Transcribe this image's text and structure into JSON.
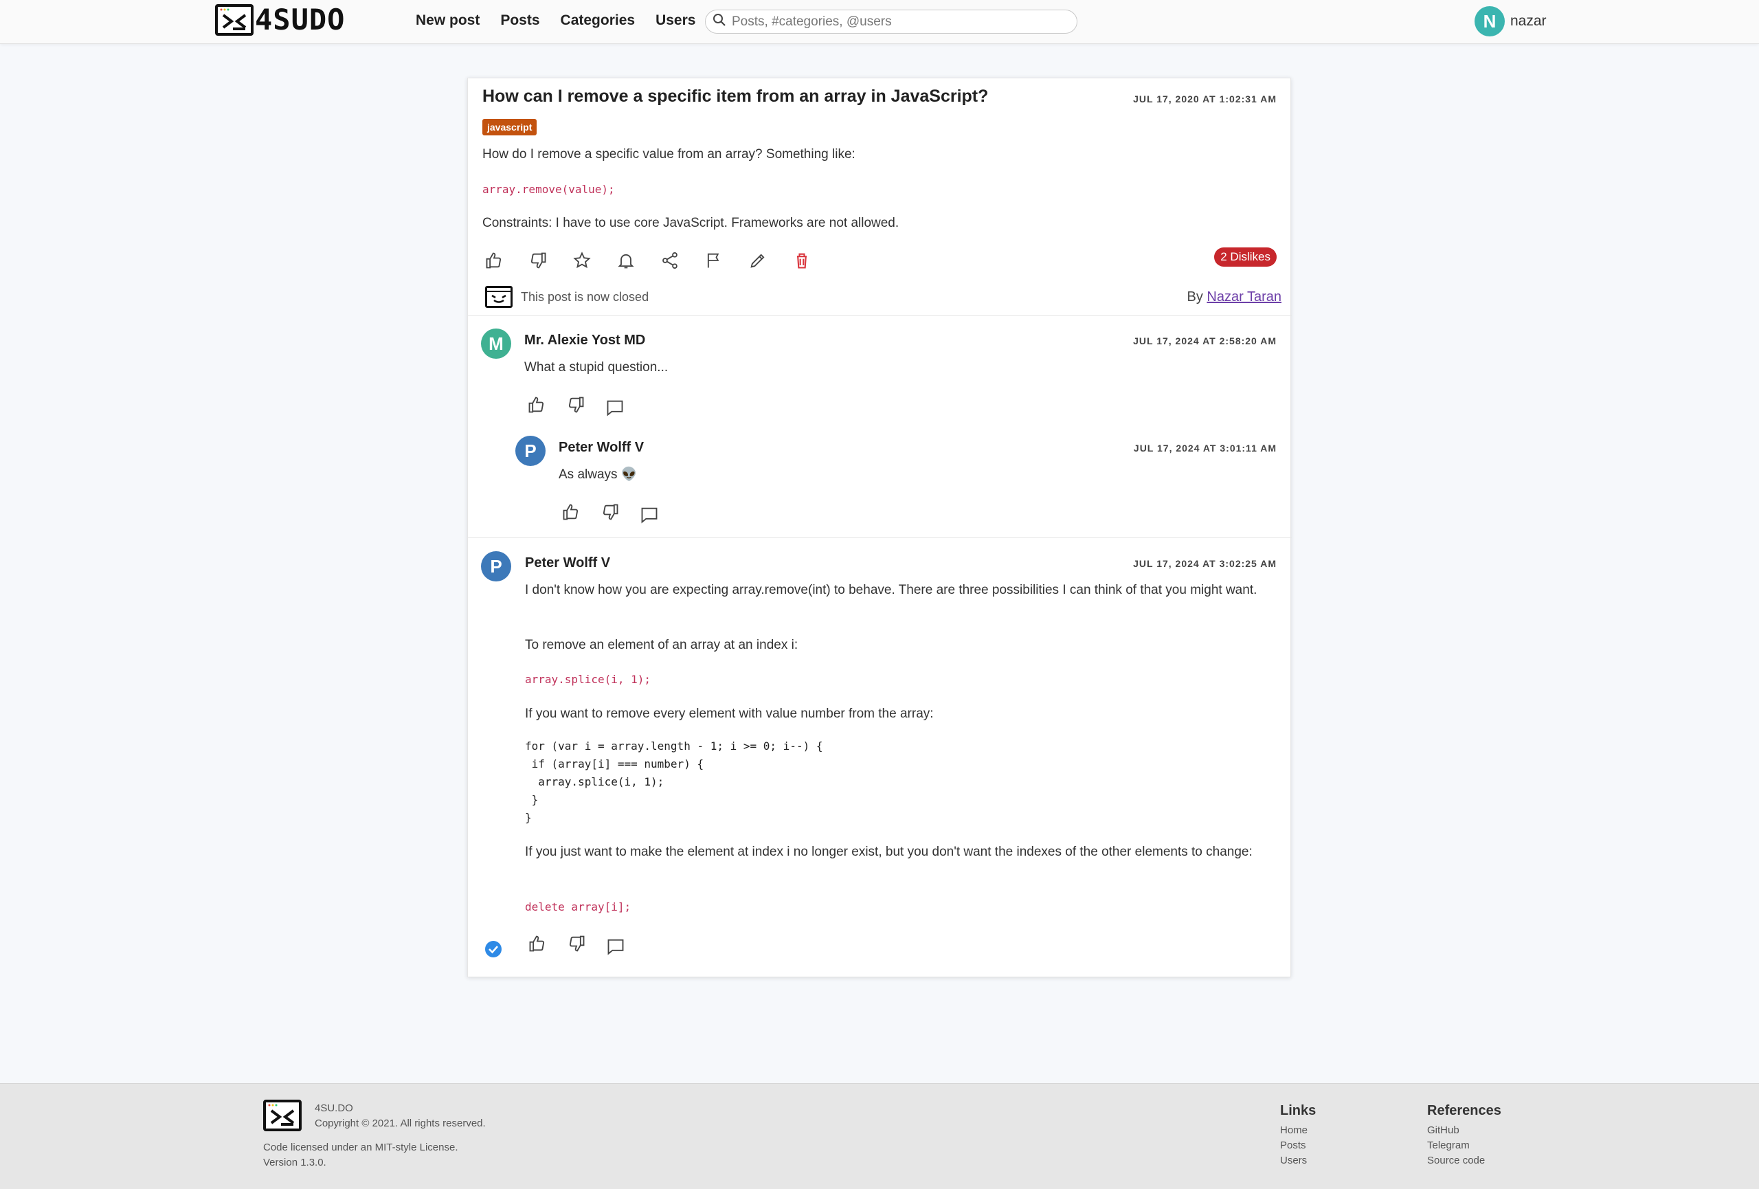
{
  "header": {
    "logo_text": "4SUDO",
    "nav": [
      "New post",
      "Posts",
      "Categories",
      "Users"
    ],
    "search_placeholder": "Posts, #categories, @users",
    "user_initial": "N",
    "user_name": "nazar"
  },
  "post": {
    "title": "How can I remove a specific item from an array in JavaScript?",
    "date": "JUL 17, 2020 AT 1:02:31 AM",
    "tag": "javascript",
    "paragraph1": "How do I remove a specific value from an array? Something like:",
    "code1": "array.remove(value);",
    "paragraph2": "Constraints: I have to use core JavaScript. Frameworks are not allowed.",
    "dislikes_badge": "2 Dislikes",
    "closed_text": "This post is now closed",
    "by_label": "By",
    "author": "Nazar Taran"
  },
  "comments": [
    {
      "initial": "M",
      "avatar_color": "#3fb192",
      "author": "Mr. Alexie Yost MD",
      "date": "JUL 17, 2024 AT 2:58:20 AM",
      "text": "What a stupid question..."
    },
    {
      "initial": "P",
      "avatar_color": "#3d79b9",
      "author": "Peter Wolff V",
      "date": "JUL 17, 2024 AT 3:01:11 AM",
      "text": "As always 👽"
    },
    {
      "initial": "P",
      "avatar_color": "#3d79b9",
      "author": "Peter Wolff V",
      "date": "JUL 17, 2024 AT 3:02:25 AM",
      "p1": "I don't know how you are expecting array.remove(int) to behave. There are three possibilities I can think of that you might want.",
      "p2": "To remove an element of an array at an index i:",
      "code1": "array.splice(i, 1);",
      "p3": "If you want to remove every element with value number from the array:",
      "pre": "for (var i = array.length - 1; i >= 0; i--) {\n if (array[i] === number) {\n  array.splice(i, 1);\n }\n}",
      "p4": "If you just want to make the element at index i no longer exist, but you don't want the indexes of the other elements to change:",
      "code2": "delete array[i];"
    }
  ],
  "footer": {
    "site": "4SU.DO",
    "copyright": "Copyright © 2021. All rights reserved.",
    "license": "Code licensed under an MIT-style License.",
    "version": "Version 1.3.0.",
    "links_title": "Links",
    "links": [
      "Home",
      "Posts",
      "Users"
    ],
    "refs_title": "References",
    "refs": [
      "GitHub",
      "Telegram",
      "Source code"
    ]
  },
  "colors": {
    "accent_teal": "#3bb5b0",
    "tag_orange": "#c3520e",
    "danger_red": "#c7272c",
    "accepted_blue": "#2e8ae6"
  }
}
